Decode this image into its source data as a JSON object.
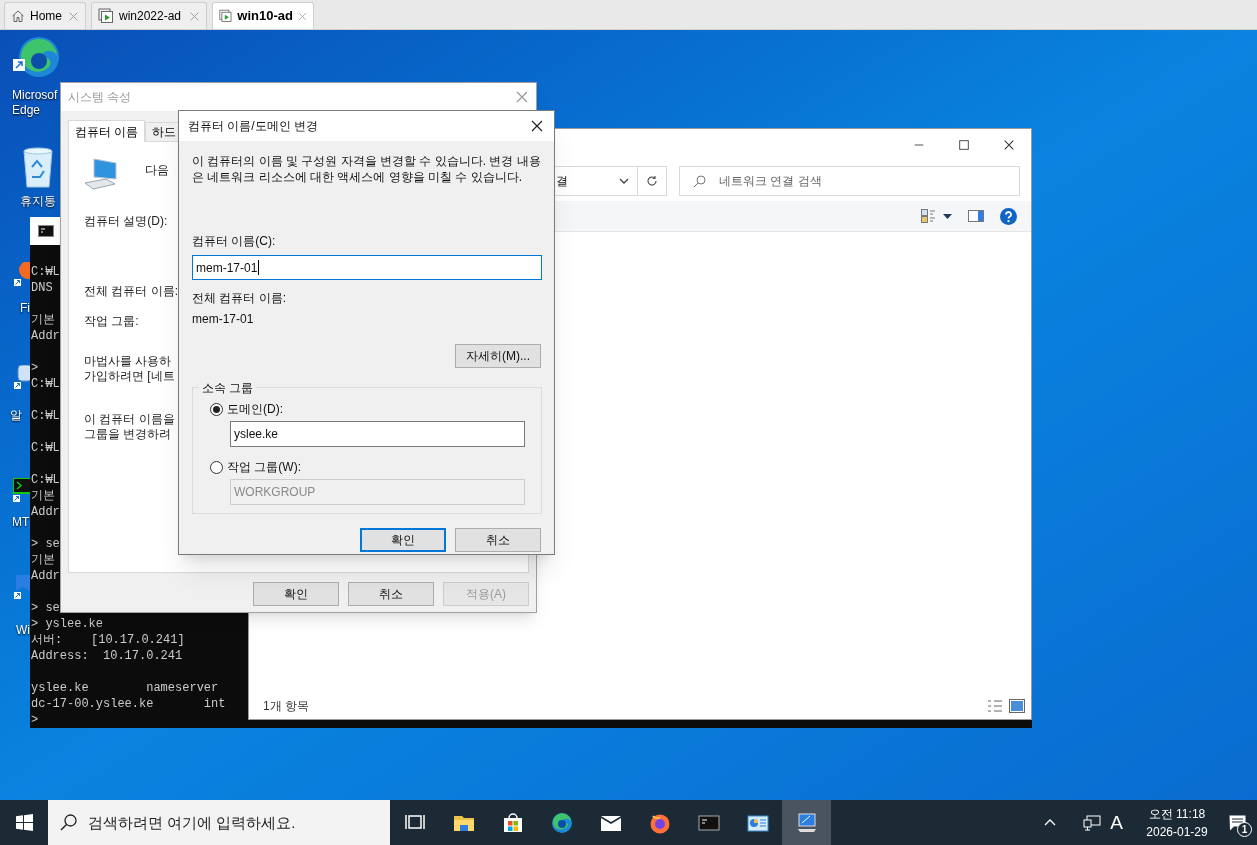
{
  "vm_tabs": [
    {
      "label": "Home",
      "kind": "home",
      "selected": false
    },
    {
      "label": "win2022-ad",
      "kind": "vm",
      "selected": false
    },
    {
      "label": "win10-ad",
      "kind": "vm",
      "selected": true
    }
  ],
  "desktop_icons": [
    {
      "kind": "edge",
      "label_lines": [
        "Microsof",
        "Edge"
      ]
    },
    {
      "kind": "recycle",
      "label_lines": [
        "휴지통"
      ]
    },
    {
      "kind": "firefox",
      "label_lines": [
        "Fi"
      ]
    },
    {
      "kind": "app",
      "label_lines": [
        "알"
      ]
    },
    {
      "kind": "terminal",
      "label_lines": [
        "MT"
      ]
    },
    {
      "kind": "bluewin",
      "label_lines": [
        "Wi"
      ]
    }
  ],
  "console": {
    "blocks": [
      [
        "C:₩L",
        "DNS"
      ],
      [
        "기본",
        "Addr"
      ],
      [
        ">",
        "C:₩L"
      ],
      [
        "C:₩L"
      ],
      [
        "C:₩L"
      ],
      [
        "C:₩L",
        "기본",
        "Addr"
      ],
      [
        "> se",
        "기본",
        "Addr"
      ],
      [
        "> se",
        "> yslee.ke",
        "서버:    [10.17.0.241]",
        "Address:  10.17.0.241"
      ],
      [
        "yslee.ke        nameserver",
        "dc-17-00.yslee.ke       int",
        ">"
      ]
    ]
  },
  "explorer": {
    "address": "결",
    "search_placeholder": "네트워크 연결 검색",
    "status": "1개 항목"
  },
  "system_properties": {
    "title": "시스템 속성",
    "tabs": [
      {
        "label": "컴퓨터 이름",
        "selected": true
      },
      {
        "label": "하드",
        "selected": false
      }
    ],
    "intro": "다음",
    "description_label": "컴퓨터 설명(D):",
    "full_name_label": "전체 컴퓨터 이름:",
    "workgroup_label": "작업 그룹:",
    "wizard_text": [
      "마법사를 사용하",
      "가입하려면 [네트"
    ],
    "rename_text": [
      "이 컴퓨터 이름을",
      "그룹을 변경하려"
    ],
    "buttons": [
      {
        "label": "확인",
        "disabled": false
      },
      {
        "label": "취소",
        "disabled": false
      },
      {
        "label": "적용(A)",
        "disabled": true
      }
    ]
  },
  "change_dialog": {
    "title": "컴퓨터 이름/도메인 변경",
    "info": "이 컴퓨터의 이름 및 구성원 자격을 변경할 수 있습니다. 변경 내용은 네트워크 리소스에 대한 액세스에 영향을 미칠 수 있습니다.",
    "computer_name_label": "컴퓨터 이름(C):",
    "computer_name": "mem-17-01",
    "full_name_label": "전체 컴퓨터 이름:",
    "full_name": "mem-17-01",
    "more_button": "자세히(M)...",
    "member_of": {
      "legend": "소속 그룹",
      "options": [
        {
          "label": "도메인(D):",
          "selected": true,
          "value": "yslee.ke"
        },
        {
          "label": "작업 그룹(W):",
          "selected": false,
          "value": "WORKGROUP"
        }
      ]
    },
    "buttons": [
      {
        "label": "확인",
        "default": true
      },
      {
        "label": "취소",
        "default": false
      }
    ]
  },
  "taskbar": {
    "search_placeholder": "검색하려면 여기에 입력하세요.",
    "apps": [
      {
        "kind": "taskview",
        "selected": false
      },
      {
        "kind": "folder",
        "selected": false
      },
      {
        "kind": "store",
        "selected": false
      },
      {
        "kind": "edge",
        "selected": false
      },
      {
        "kind": "mail",
        "selected": false
      },
      {
        "kind": "firefox",
        "selected": false
      },
      {
        "kind": "cmd",
        "selected": false
      },
      {
        "kind": "panel",
        "selected": false
      },
      {
        "kind": "sysprops",
        "selected": true
      }
    ],
    "ime": "A",
    "time": "오전 11:18",
    "date": "2026-01-29",
    "notifications": "1"
  }
}
